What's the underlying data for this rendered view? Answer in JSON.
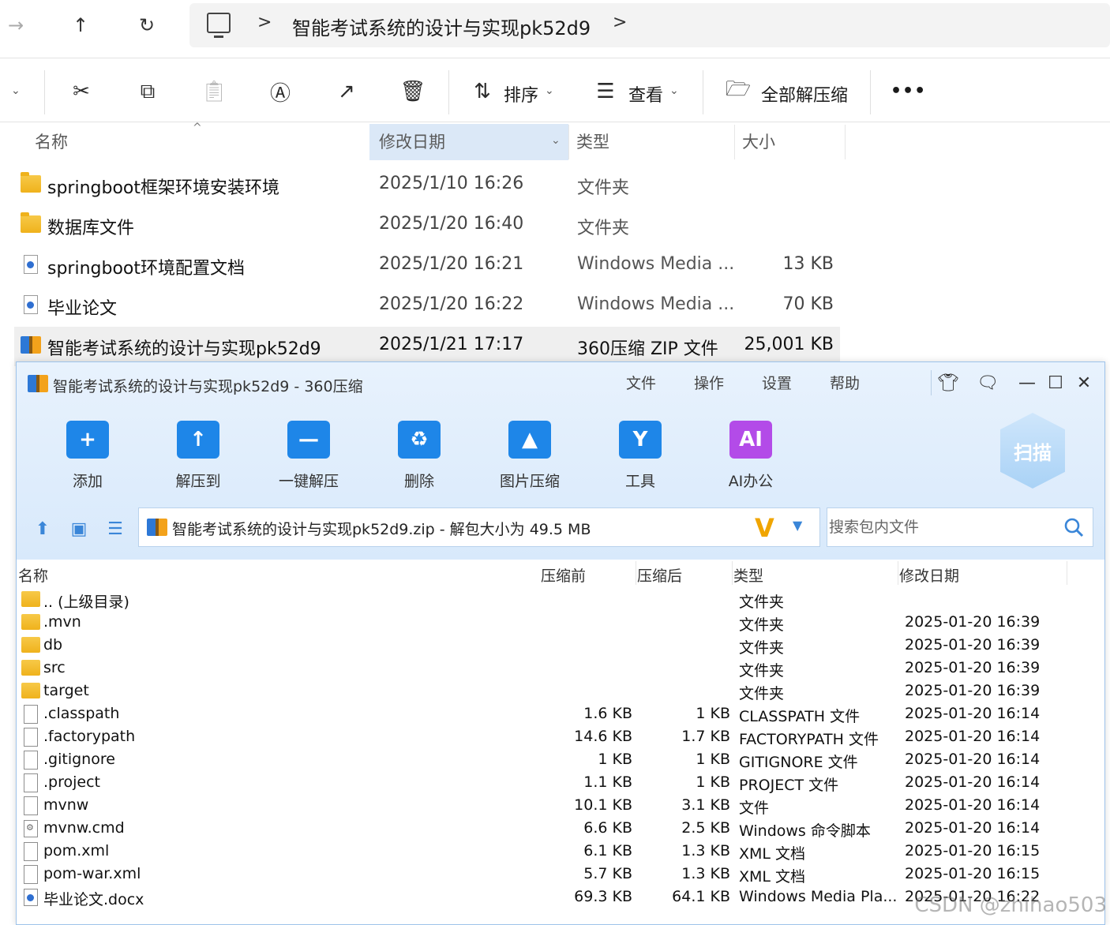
{
  "explorer": {
    "nav": {
      "forward": "→",
      "up": "↑",
      "refresh": "↻"
    },
    "breadcrumb": {
      "separator": ">",
      "current": "智能考试系统的设计与实现pk52d9",
      "trailing": ">"
    },
    "toolbar": {
      "sort_label": "排序",
      "view_label": "查看",
      "extract_all_label": "全部解压缩",
      "more_label": "•••"
    },
    "columns": {
      "name": "名称",
      "date": "修改日期",
      "type": "类型",
      "size": "大小"
    },
    "rows": [
      {
        "icon": "folder",
        "name": "springboot框架环境安装环境",
        "date": "2025/1/10 16:26",
        "type": "文件夹",
        "size": ""
      },
      {
        "icon": "folder",
        "name": "数据库文件",
        "date": "2025/1/20 16:40",
        "type": "文件夹",
        "size": ""
      },
      {
        "icon": "doc",
        "name": "springboot环境配置文档",
        "date": "2025/1/20 16:21",
        "type": "Windows Media ...",
        "size": "13 KB"
      },
      {
        "icon": "doc",
        "name": "毕业论文",
        "date": "2025/1/20 16:22",
        "type": "Windows Media ...",
        "size": "70 KB"
      },
      {
        "icon": "zip",
        "name": "智能考试系统的设计与实现pk52d9",
        "date": "2025/1/21 17:17",
        "type": "360压缩 ZIP 文件",
        "size": "25,001 KB"
      }
    ]
  },
  "zip": {
    "title": "智能考试系统的设计与实现pk52d9 - 360压缩",
    "menu": [
      "文件",
      "操作",
      "设置",
      "帮助"
    ],
    "tools": [
      {
        "label": "添加",
        "color": "#1e86e8",
        "glyph": "+"
      },
      {
        "label": "解压到",
        "color": "#1e86e8",
        "glyph": "↑"
      },
      {
        "label": "一键解压",
        "color": "#1e86e8",
        "glyph": "—"
      },
      {
        "label": "删除",
        "color": "#1e86e8",
        "glyph": "♻"
      },
      {
        "label": "图片压缩",
        "color": "#1e86e8",
        "glyph": "▲"
      },
      {
        "label": "工具",
        "color": "#1e86e8",
        "glyph": "Y"
      },
      {
        "label": "AI办公",
        "color": "#b34be8",
        "glyph": "AI"
      }
    ],
    "scan_label": "扫描",
    "path": "智能考试系统的设计与实现pk52d9.zip - 解包大小为 49.5 MB",
    "search_placeholder": "搜索包内文件",
    "columns": {
      "name": "名称",
      "before": "压缩前",
      "after": "压缩后",
      "type": "类型",
      "date": "修改日期"
    },
    "rows": [
      {
        "icon": "folder",
        "name": ".. (上级目录)",
        "before": "",
        "after": "",
        "type": "文件夹",
        "date": ""
      },
      {
        "icon": "folder",
        "name": ".mvn",
        "before": "",
        "after": "",
        "type": "文件夹",
        "date": "2025-01-20 16:39"
      },
      {
        "icon": "folder",
        "name": "db",
        "before": "",
        "after": "",
        "type": "文件夹",
        "date": "2025-01-20 16:39"
      },
      {
        "icon": "folder",
        "name": "src",
        "before": "",
        "after": "",
        "type": "文件夹",
        "date": "2025-01-20 16:39"
      },
      {
        "icon": "folder",
        "name": "target",
        "before": "",
        "after": "",
        "type": "文件夹",
        "date": "2025-01-20 16:39"
      },
      {
        "icon": "file",
        "name": ".classpath",
        "before": "1.6 KB",
        "after": "1 KB",
        "type": "CLASSPATH 文件",
        "date": "2025-01-20 16:14"
      },
      {
        "icon": "file",
        "name": ".factorypath",
        "before": "14.6 KB",
        "after": "1.7 KB",
        "type": "FACTORYPATH 文件",
        "date": "2025-01-20 16:14"
      },
      {
        "icon": "file",
        "name": ".gitignore",
        "before": "1 KB",
        "after": "1 KB",
        "type": "GITIGNORE 文件",
        "date": "2025-01-20 16:14"
      },
      {
        "icon": "file",
        "name": ".project",
        "before": "1.1 KB",
        "after": "1 KB",
        "type": "PROJECT 文件",
        "date": "2025-01-20 16:14"
      },
      {
        "icon": "file",
        "name": "mvnw",
        "before": "10.1 KB",
        "after": "3.1 KB",
        "type": "文件",
        "date": "2025-01-20 16:14"
      },
      {
        "icon": "cmd",
        "name": "mvnw.cmd",
        "before": "6.6 KB",
        "after": "2.5 KB",
        "type": "Windows 命令脚本",
        "date": "2025-01-20 16:14"
      },
      {
        "icon": "file",
        "name": "pom.xml",
        "before": "6.1 KB",
        "after": "1.3 KB",
        "type": "XML 文档",
        "date": "2025-01-20 16:15"
      },
      {
        "icon": "file",
        "name": "pom-war.xml",
        "before": "5.7 KB",
        "after": "1.3 KB",
        "type": "XML 文档",
        "date": "2025-01-20 16:15"
      },
      {
        "icon": "doc",
        "name": "毕业论文.docx",
        "before": "69.3 KB",
        "after": "64.1 KB",
        "type": "Windows Media Pla...",
        "date": "2025-01-20 16:22"
      }
    ]
  },
  "watermark": "CSDN @zhihao503"
}
